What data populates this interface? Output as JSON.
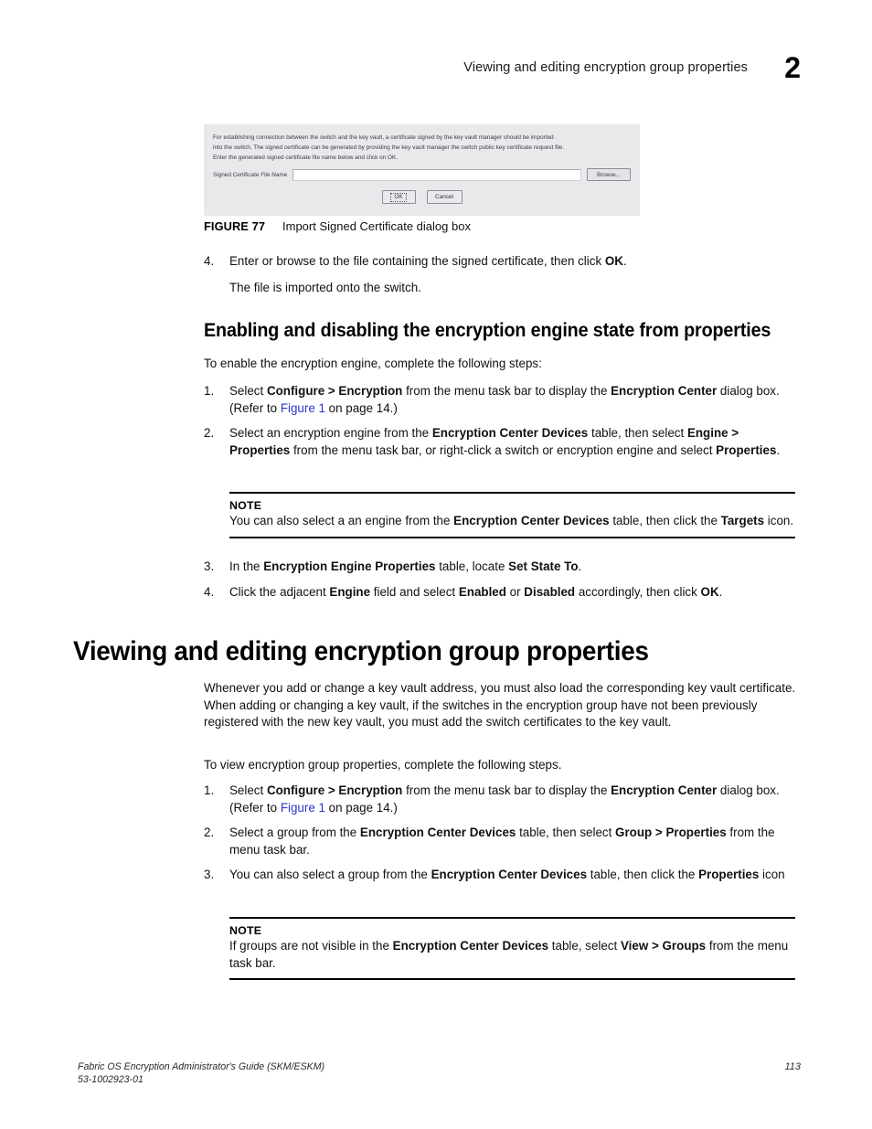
{
  "header": {
    "running_title": "Viewing and editing encryption group properties",
    "chapter_number": "2"
  },
  "figure": {
    "caption_number": "FIGURE 77",
    "caption_title": "Import Signed Certificate dialog box",
    "dialog": {
      "paragraph_line1": "For establishing connection between the switch and the key vault, a certificate signed by the key vault manager should be imported",
      "paragraph_line2": "into the switch. The signed certificate can be generated by providing the key vault manager the switch public key certificate request file.",
      "paragraph_line3": "Enter the generated signed certificate file name below and click on OK.",
      "field_label": "Signed Certificate File Name",
      "field_value": "",
      "browse_label": "Browse...",
      "ok_label": "OK",
      "cancel_label": "Cancel"
    }
  },
  "step4_import": {
    "number": "4.",
    "line1_a": "Enter or browse to the file containing the signed certificate, then click ",
    "line1_bold": "OK",
    "line1_b": ".",
    "result": "The file is imported onto the switch."
  },
  "section_engine_state": {
    "heading": "Enabling and disabling the encryption engine state from properties",
    "intro": "To enable the encryption engine, complete the following steps:",
    "steps": [
      {
        "number": "1.",
        "t1": "Select ",
        "b1": "Configure > Encryption",
        "t2": " from the menu task bar to display the ",
        "b2": "Encryption Center",
        "t3": " dialog box. (Refer to ",
        "link": "Figure 1",
        "t4": " on page 14.)"
      },
      {
        "number": "2.",
        "t1": "Select an encryption engine from the ",
        "b1": "Encryption Center Devices",
        "t2": " table, then select ",
        "b2": "Engine > Properties",
        "t3": " from the menu task bar, or right-click a switch or encryption engine and select ",
        "b3": "Properties",
        "t4": "."
      },
      {
        "number": "3.",
        "t1": "In the ",
        "b1": "Encryption Engine Properties",
        "t2": " table, locate ",
        "b2": "Set State To",
        "t3": "."
      },
      {
        "number": "4.",
        "t1": "Click the adjacent ",
        "b1": "Engine",
        "t2": " field and select ",
        "b2": "Enabled",
        "t3": " or ",
        "b3": "Disabled",
        "t4": " accordingly, then click ",
        "b4": "OK",
        "t5": "."
      }
    ],
    "note": {
      "label": "NOTE",
      "t1": "You can also select a an engine from the ",
      "b1": "Encryption Center Devices",
      "t2": " table, then click the ",
      "b2": "Targets",
      "t3": " icon."
    }
  },
  "section_group_properties": {
    "heading": "Viewing and editing encryption group properties",
    "paragraph": "Whenever you add or change a key vault address, you must also load the corresponding key vault certificate. When adding or changing a key vault, if the switches in the encryption group have not been previously registered with the new key vault, you must add the switch certificates to the key vault.",
    "intro": "To view encryption group properties, complete the following steps.",
    "steps": [
      {
        "number": "1.",
        "t1": "Select ",
        "b1": "Configure > Encryption",
        "t2": " from the menu task bar to display the ",
        "b2": "Encryption Center",
        "t3": " dialog box. (Refer to ",
        "link": "Figure 1",
        "t4": " on page 14.)"
      },
      {
        "number": "2.",
        "t1": "Select a group from the ",
        "b1": "Encryption Center Devices",
        "t2": " table, then select ",
        "b2": "Group > Properties",
        "t3": " from the menu task bar."
      },
      {
        "number": "3.",
        "t1": "You can also select a group from the ",
        "b1": "Encryption Center Devices",
        "t2": " table, then click the ",
        "b2": "Properties",
        "t3": " icon"
      }
    ],
    "note": {
      "label": "NOTE",
      "t1": "If groups are not visible in the ",
      "b1": "Encryption Center Devices",
      "t2": " table, select ",
      "b2": "View > Groups",
      "t3": " from the menu task bar."
    }
  },
  "footer": {
    "line1": "Fabric OS Encryption Administrator's Guide (SKM/ESKM)",
    "line2": "53-1002923-01",
    "page_number": "113"
  },
  "colors": {
    "link": "#2b35d0",
    "text": "#111111",
    "dialog_bg": "#e9e9ec"
  }
}
